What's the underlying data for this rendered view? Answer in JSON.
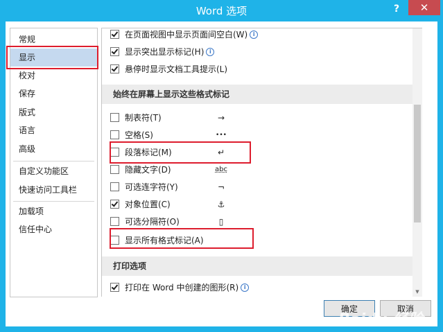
{
  "window": {
    "title": "Word 选项",
    "help_glyph": "?",
    "close_glyph": "✕"
  },
  "nav": {
    "items": [
      {
        "label": "常规"
      },
      {
        "label": "显示",
        "selected": true
      },
      {
        "label": "校对"
      },
      {
        "label": "保存"
      },
      {
        "label": "版式"
      },
      {
        "label": "语言"
      },
      {
        "label": "高级"
      },
      {
        "label": "自定义功能区"
      },
      {
        "label": "快速访问工具栏"
      },
      {
        "label": "加载项"
      },
      {
        "label": "信任中心"
      }
    ]
  },
  "page_options": [
    {
      "label": "在页面视图中显示页面间空白(W)",
      "checked": true,
      "info": true
    },
    {
      "label": "显示突出显示标记(H)",
      "checked": true,
      "info": true
    },
    {
      "label": "悬停时显示文档工具提示(L)",
      "checked": true,
      "info": false
    }
  ],
  "format_marks": {
    "header": "始终在屏幕上显示这些格式标记",
    "items": [
      {
        "label": "制表符(T)",
        "checked": false,
        "symbol": "→"
      },
      {
        "label": "空格(S)",
        "checked": false,
        "symbol": "•••"
      },
      {
        "label": "段落标记(M)",
        "checked": false,
        "symbol": "↵"
      },
      {
        "label": "隐藏文字(D)",
        "checked": false,
        "symbol": "abc"
      },
      {
        "label": "可选连字符(Y)",
        "checked": false,
        "symbol": "¬"
      },
      {
        "label": "对象位置(C)",
        "checked": true,
        "symbol": "⚓"
      },
      {
        "label": "可选分隔符(O)",
        "checked": false,
        "symbol": "▯"
      },
      {
        "label": "显示所有格式标记(A)",
        "checked": false,
        "symbol": ""
      }
    ]
  },
  "print": {
    "header": "打印选项",
    "items": [
      {
        "label": "打印在 Word 中创建的图形(R)",
        "checked": true,
        "info": true
      }
    ]
  },
  "buttons": {
    "ok": "确定",
    "cancel": "取消"
  },
  "watermark": "Baidu 经验",
  "colors": {
    "titlebar": "#1fb3e8",
    "close": "#c74b50",
    "highlight": "#dd1c2d",
    "nav_selected": "#c5d9ef"
  }
}
